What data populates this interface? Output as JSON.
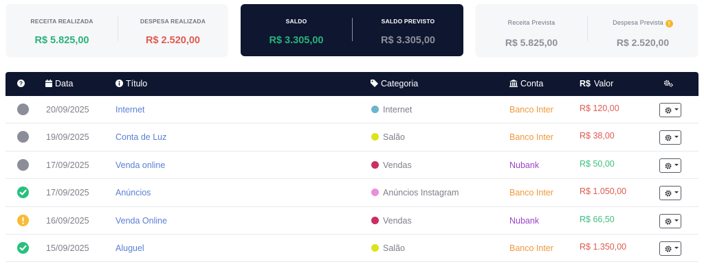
{
  "summary": {
    "realized": {
      "income_label": "RECEITA REALIZADA",
      "income_value": "R$ 5.825,00",
      "expense_label": "DESPESA REALIZADA",
      "expense_value": "R$ 2.520,00"
    },
    "balance": {
      "label": "SALDO",
      "value": "R$ 3.305,00",
      "forecast_label": "SALDO PREVISTO",
      "forecast_value": "R$ 3.305,00"
    },
    "forecast": {
      "income_label": "Receita Prevista",
      "income_value": "R$ 5.825,00",
      "expense_label": "Despesa Prevista",
      "expense_value": "R$ 2.520,00",
      "warn_glyph": "!"
    }
  },
  "table": {
    "headers": {
      "status": "",
      "date": "Data",
      "title": "Título",
      "category": "Categoria",
      "account": "Conta",
      "value_symbol": "R$",
      "value": "Valor"
    },
    "rows": [
      {
        "status": "pending",
        "date": "20/09/2025",
        "title": "Internet",
        "category": "Internet",
        "category_color": "#6bb6cc",
        "account": "Banco Inter",
        "account_color": "#f0983a",
        "value": "R$ 120,00",
        "value_color": "#e05a4f"
      },
      {
        "status": "pending",
        "date": "19/09/2025",
        "title": "Conta de Luz",
        "category": "Salão",
        "category_color": "#dde31b",
        "account": "Banco Inter",
        "account_color": "#f0983a",
        "value": "R$ 38,00",
        "value_color": "#e05a4f"
      },
      {
        "status": "pending",
        "date": "17/09/2025",
        "title": "Venda online",
        "category": "Vendas",
        "category_color": "#c92f62",
        "account": "Nubank",
        "account_color": "#9b44c6",
        "value": "R$ 50,00",
        "value_color": "#3fbf7f"
      },
      {
        "status": "done",
        "date": "17/09/2025",
        "title": "Anúncios",
        "category": "Anúncios Instagram",
        "category_color": "#ea8fd9",
        "account": "Banco Inter",
        "account_color": "#f0983a",
        "value": "R$ 1.050,00",
        "value_color": "#e05a4f"
      },
      {
        "status": "warn",
        "date": "16/09/2025",
        "title": "Venda Online",
        "category": "Vendas",
        "category_color": "#c92f62",
        "account": "Nubank",
        "account_color": "#9b44c6",
        "value": "R$ 66,50",
        "value_color": "#3fbf7f"
      },
      {
        "status": "done",
        "date": "15/09/2025",
        "title": "Aluguel",
        "category": "Salão",
        "category_color": "#dde31b",
        "account": "Banco Inter",
        "account_color": "#f0983a",
        "value": "R$ 1.350,00",
        "value_color": "#e05a4f"
      }
    ]
  }
}
